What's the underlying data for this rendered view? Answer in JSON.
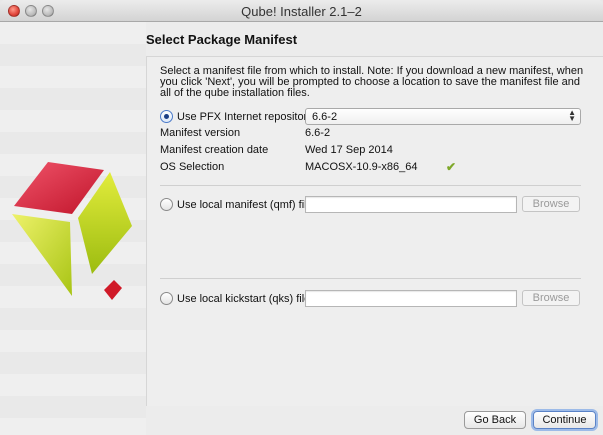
{
  "window": {
    "title": "Qube! Installer 2.1–2"
  },
  "page": {
    "heading": "Select Package Manifest",
    "intro": "Select a manifest file from which to install. Note: If you download a new manifest, when you click 'Next', you will be prompted to choose a location to save the manifest file and all of the qube installation files."
  },
  "options": {
    "pfx": {
      "label": "Use PFX Internet repository",
      "selected": true,
      "version_select": "6.6-2"
    },
    "local_manifest": {
      "label": "Use local manifest (qmf) file",
      "value": "",
      "browse_label": "Browse"
    },
    "local_kickstart": {
      "label": "Use local kickstart (qks) file",
      "value": "",
      "browse_label": "Browse"
    }
  },
  "info": {
    "manifest_version_label": "Manifest version",
    "manifest_version_value": "6.6-2",
    "creation_date_label": "Manifest creation date",
    "creation_date_value": "Wed 17 Sep 2014",
    "os_selection_label": "OS Selection",
    "os_selection_value": "MACOSX-10.9-x86_64",
    "os_check_icon": "checkmark-icon"
  },
  "buttons": {
    "back": "Go Back",
    "continue": "Continue"
  },
  "colors": {
    "accent": "#4c7bc9",
    "check": "#7fa82a",
    "logo_red": "#e0333f",
    "logo_green": "#c8dc1e"
  }
}
